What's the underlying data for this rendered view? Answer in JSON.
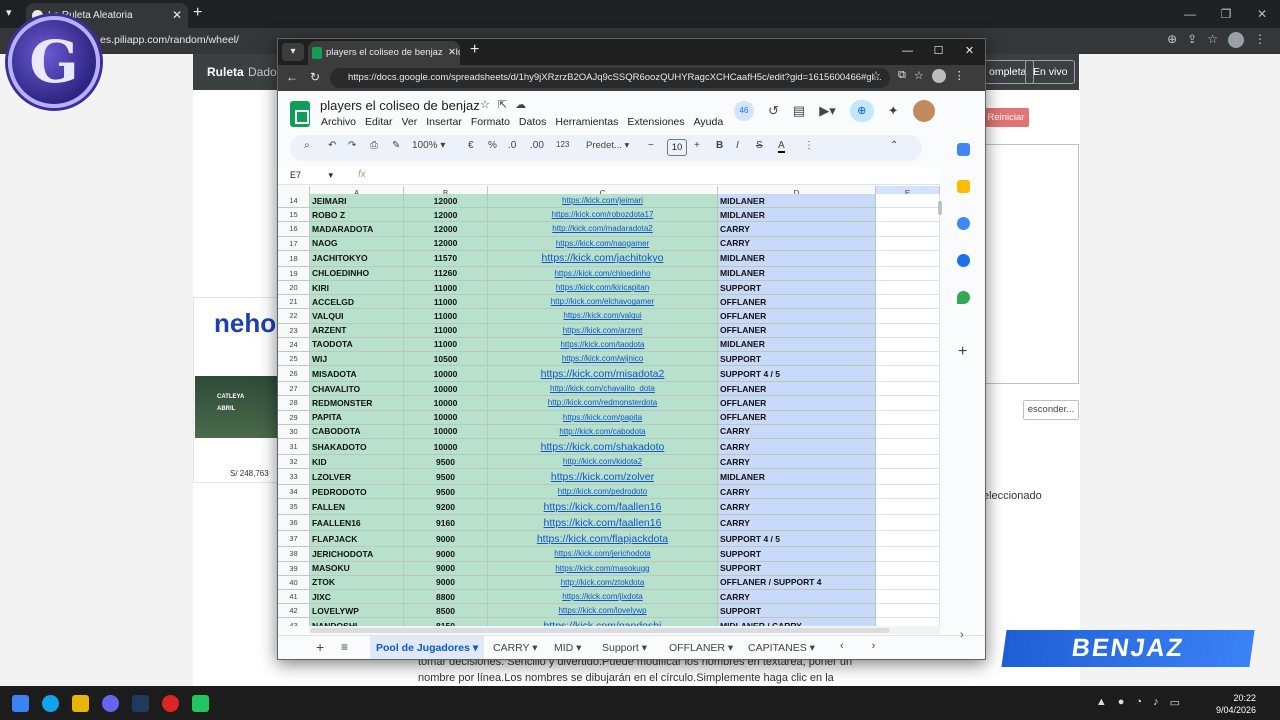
{
  "bg_browser": {
    "tab_title": "La Ruleta Aleatoria",
    "url": "es.piliapp.com/random/wheel/",
    "nav_items": [
      "Ruleta",
      "Dado"
    ],
    "nav_buttons": [
      "ompleta",
      "En vivo"
    ],
    "reiniciar": "Reiniciar",
    "esconder": "esconder...",
    "seleccionado": "eleccionado",
    "paragraph": "tomar decisiones. Sencillo y divertido.Puede modificar los nombres en textarea, poner un nombre por línea.Los nombres se dibujarán en el círculo.Simplemente haga clic en la rueda",
    "ad_brand": "neho",
    "ad_labels": [
      "CATLEYA",
      "ABRIL"
    ],
    "ad_price": "S/ 248,763"
  },
  "overlay": {
    "logo_letter": "G",
    "streamer": "BENJAZ"
  },
  "window": {
    "tab_title": "players el coliseo de benjaz - Hoja",
    "url": "https://docs.google.com/spreadsheets/d/1hy9jXRzrzB2OAJq9cSSQR6oozQUHYRagcXCHCaafH5c/edit?gid=1615600466#gi..."
  },
  "sheets": {
    "doc_title": "players el coliseo de benjaz",
    "menus": [
      "Archivo",
      "Editar",
      "Ver",
      "Insertar",
      "Formato",
      "Datos",
      "Herramientas",
      "Extensiones",
      "Ayuda"
    ],
    "badge_count": "46",
    "toolbar": {
      "zoom": "100%",
      "currency": "€",
      "percent": "%",
      "dec_less": ".0",
      "dec_more": ".00",
      "format_123": "123",
      "font": "Predet...",
      "font_size": "10"
    },
    "name_box": "E7",
    "fx": "fx",
    "columns": [
      "A",
      "B",
      "C",
      "D",
      "E"
    ],
    "rows": [
      {
        "n": "14",
        "name": "JEIMARI",
        "mmr": "12000",
        "link": "https://kick.com/jeimari",
        "role": "MIDLANER",
        "big": false
      },
      {
        "n": "15",
        "name": "ROBO Z",
        "mmr": "12000",
        "link": "https://kick.com/robozdota17",
        "role": "MIDLANER",
        "big": false
      },
      {
        "n": "16",
        "name": "MADARADOTA",
        "mmr": "12000",
        "link": "http://kick.com/madaradota2",
        "role": "CARRY",
        "big": false
      },
      {
        "n": "17",
        "name": "NAOG",
        "mmr": "12000",
        "link": "https://kick.com/naogamer",
        "role": "CARRY",
        "big": false
      },
      {
        "n": "18",
        "name": "JACHITOKYO",
        "mmr": "11570",
        "link": "https://kick.com/jachitokyo",
        "role": "MIDLANER",
        "big": true
      },
      {
        "n": "19",
        "name": "CHLOEDINHO",
        "mmr": "11260",
        "link": "https://kick.com/chloedinho",
        "role": "MIDLANER",
        "big": false
      },
      {
        "n": "20",
        "name": "KIRI",
        "mmr": "11000",
        "link": "https://kick.com/kiricapitan",
        "role": "SUPPORT",
        "big": false
      },
      {
        "n": "21",
        "name": "ACCELGD",
        "mmr": "11000",
        "link": "http://kick.com/elchavogamer",
        "role": "OFFLANER",
        "big": false
      },
      {
        "n": "22",
        "name": "VALQUI",
        "mmr": "11000",
        "link": "https://kick.com/valqui",
        "role": "OFFLANER",
        "big": false
      },
      {
        "n": "23",
        "name": "ARZENT",
        "mmr": "11000",
        "link": "https://kick.com/arzent",
        "role": "OFFLANER",
        "big": false
      },
      {
        "n": "24",
        "name": "TAODOTA",
        "mmr": "11000",
        "link": "https://kick.com/taodota",
        "role": "MIDLANER",
        "big": false
      },
      {
        "n": "25",
        "name": "WIJ",
        "mmr": "10500",
        "link": "https://kick.com/wijnico",
        "role": "SUPPORT",
        "big": false
      },
      {
        "n": "26",
        "name": "MISADOTA",
        "mmr": "10000",
        "link": "https://kick.com/misadota2",
        "role": "SUPPORT 4 / 5",
        "big": true
      },
      {
        "n": "27",
        "name": "CHAVALITO",
        "mmr": "10000",
        "link": "http://kick.com/chavalito_dota",
        "role": "OFFLANER",
        "big": false
      },
      {
        "n": "28",
        "name": "REDMONSTER",
        "mmr": "10000",
        "link": "http://kick.com/redmonsterdota",
        "role": "OFFLANER",
        "big": false
      },
      {
        "n": "29",
        "name": "PAPITA",
        "mmr": "10000",
        "link": "https://kick.com/papita",
        "role": "OFFLANER",
        "big": false
      },
      {
        "n": "30",
        "name": "CABODOTA",
        "mmr": "10000",
        "link": "http://kick.com/cabodota",
        "role": "CARRY",
        "big": false
      },
      {
        "n": "31",
        "name": "SHAKADOTO",
        "mmr": "10000",
        "link": "https://kick.com/shakadoto",
        "role": "CARRY",
        "big": true
      },
      {
        "n": "32",
        "name": "KID",
        "mmr": "9500",
        "link": "http://kick.com/kidota2",
        "role": "CARRY",
        "big": false
      },
      {
        "n": "33",
        "name": "LZOLVER",
        "mmr": "9500",
        "link": "https://kick.com/zolver",
        "role": "MIDLANER",
        "big": true
      },
      {
        "n": "34",
        "name": "PEDRODOTO",
        "mmr": "9500",
        "link": "http://kick.com/pedrodoto",
        "role": "CARRY",
        "big": false
      },
      {
        "n": "35",
        "name": "FALLEN",
        "mmr": "9200",
        "link": "https://kick.com/faallen16",
        "role": "CARRY",
        "big": true
      },
      {
        "n": "36",
        "name": "FAALLEN16",
        "mmr": "9160",
        "link": "https://kick.com/faallen16",
        "role": "CARRY",
        "big": true
      },
      {
        "n": "37",
        "name": "FLAPJACK",
        "mmr": "9000",
        "link": "https://kick.com/flapjackdota",
        "role": "SUPPORT 4 / 5",
        "big": true
      },
      {
        "n": "38",
        "name": "JERICHODOTA",
        "mmr": "9000",
        "link": "https://kick.com/jerichodota",
        "role": "SUPPORT",
        "big": false
      },
      {
        "n": "39",
        "name": "MASOKU",
        "mmr": "9000",
        "link": "https://kick.com/masokugg",
        "role": "SUPPORT",
        "big": false
      },
      {
        "n": "40",
        "name": "ZTOK",
        "mmr": "9000",
        "link": "http://kick.com/ztokdota",
        "role": "OFFLANER / SUPPORT 4",
        "big": false
      },
      {
        "n": "41",
        "name": "JIXC",
        "mmr": "8800",
        "link": "https://kick.com/jixdota",
        "role": "CARRY",
        "big": false
      },
      {
        "n": "42",
        "name": "LOVELYWP",
        "mmr": "8500",
        "link": "https://kick.com/lovelywp",
        "role": "SUPPORT",
        "big": false
      },
      {
        "n": "43",
        "name": "NANDOSHI",
        "mmr": "8150",
        "link": "https://kick.com/nandoshi",
        "role": "MIDLANER / CARRY",
        "big": true
      }
    ],
    "sheet_tabs": [
      {
        "label": "Pool de Jugadores",
        "active": true
      },
      {
        "label": "CARRY",
        "active": false
      },
      {
        "label": "MID",
        "active": false
      },
      {
        "label": "Support",
        "active": false
      },
      {
        "label": "OFFLANER",
        "active": false
      },
      {
        "label": "CAPITANES",
        "active": false
      }
    ]
  },
  "taskbar": {
    "time": "20:22",
    "date": "9/04/2026"
  },
  "colors": {
    "name_fill": "#b7e1cd",
    "role_fill": "#c9daf8",
    "link": "#1155cc",
    "sheets_green": "#0f9d58",
    "accent": "#0b57d0"
  }
}
